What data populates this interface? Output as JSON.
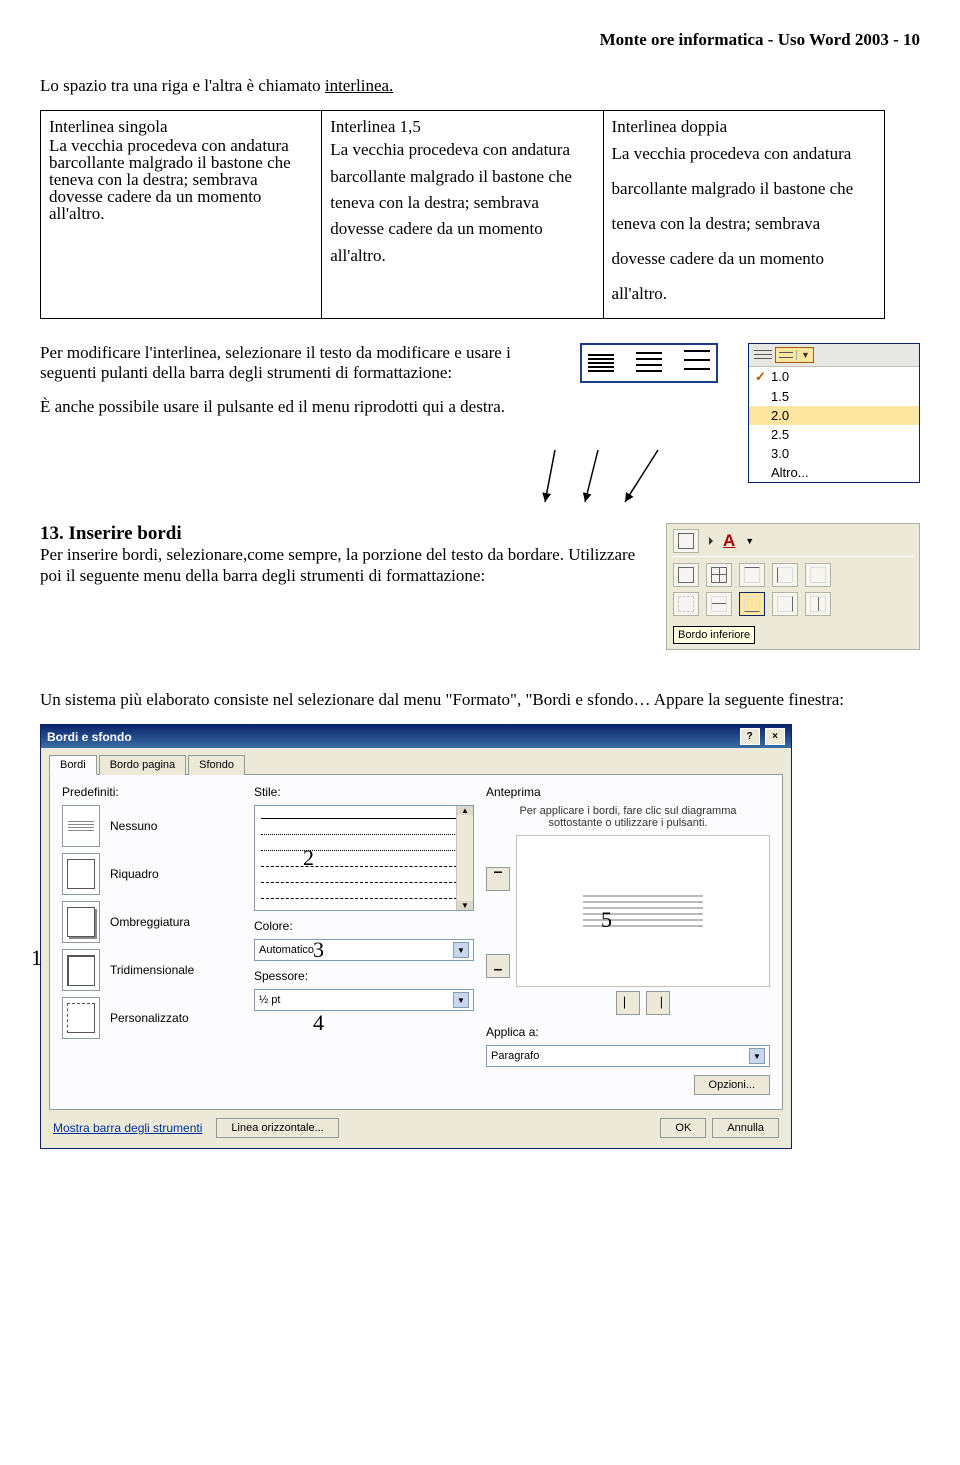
{
  "header": "Monte ore informatica - Uso Word 2003 - 10",
  "intro_a": "Lo spazio tra una riga e l'altra è chiamato ",
  "intro_b": "interlinea.",
  "tbl": {
    "h1": "Interlinea singola",
    "h2": "Interlinea 1,5",
    "h3": "Interlinea doppia",
    "sample": "La vecchia procedeva con andatura barcollante malgrado il bastone che teneva con la destra; sembrava dovesse cadere da un momento all'altro."
  },
  "para1": "Per modificare l'interlinea, selezionare il testo da modificare e usare i seguenti pulanti della barra degli strumenti di formattazione:",
  "para2": "È anche possibile usare il pulsante ed il menu riprodotti qui a destra.",
  "ls_menu": {
    "items": [
      "1.0",
      "1.5",
      "2.0",
      "2.5",
      "3.0",
      "Altro..."
    ],
    "checked": "1.0",
    "selected": "2.0"
  },
  "sec13_title": "13. Inserire bordi",
  "sec13_body": "Per inserire bordi, selezionare,come sempre, la porzione del testo da bordare. Utilizzare poi il seguente menu della barra degli strumenti di formattazione:",
  "border_tip": "Bordo inferiore",
  "para3": "Un sistema più elaborato consiste nel selezionare dal menu \"Formato\", \"Bordi e sfondo… Appare la seguente finestra:",
  "dlg": {
    "title": "Bordi e sfondo",
    "tabs": [
      "Bordi",
      "Bordo pagina",
      "Sfondo"
    ],
    "predef_label": "Predefiniti:",
    "presets": [
      "Nessuno",
      "Riquadro",
      "Ombreggiatura",
      "Tridimensionale",
      "Personalizzato"
    ],
    "style_label": "Stile:",
    "color_label": "Colore:",
    "color_val": "Automatico",
    "weight_label": "Spessore:",
    "weight_val": "½ pt",
    "preview_label": "Anteprima",
    "preview_hint": "Per applicare i bordi, fare clic sul diagramma sottostante o utilizzare i pulsanti.",
    "apply_label": "Applica a:",
    "apply_val": "Paragrafo",
    "options": "Opzioni...",
    "show_toolbar": "Mostra barra degli strumenti",
    "hr": "Linea orizzontale...",
    "ok": "OK",
    "cancel": "Annulla"
  },
  "overlay": {
    "n1": "1",
    "n2": "2",
    "n3": "3",
    "n4": "4",
    "n5": "5"
  }
}
